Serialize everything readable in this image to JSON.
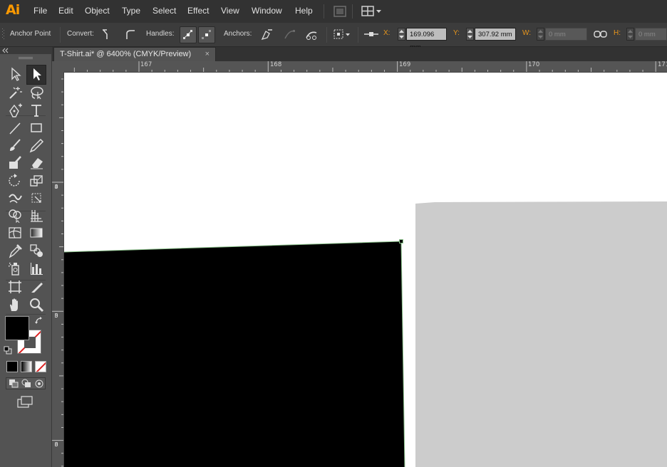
{
  "app": {
    "logo": "Ai"
  },
  "menu": [
    "File",
    "Edit",
    "Object",
    "Type",
    "Select",
    "Effect",
    "View",
    "Window",
    "Help"
  ],
  "control_bar": {
    "selection_label": "Anchor Point",
    "convert_label": "Convert:",
    "handles_label": "Handles:",
    "anchors_label": "Anchors:",
    "x_label": "X:",
    "x_value": "169.096 mm",
    "y_label": "Y:",
    "y_value": "307.92 mm",
    "w_label": "W:",
    "w_value": "0 mm",
    "h_label": "H:",
    "h_value": "0 mm"
  },
  "document": {
    "tab_title": "T-Shirt.ai* @ 6400% (CMYK/Preview)",
    "close_glyph": "×"
  },
  "ruler": {
    "top_labels": [
      "167",
      "168",
      "169",
      "170",
      "171"
    ],
    "left_labels": [
      [
        "3",
        "0",
        "4"
      ],
      [
        "3",
        "0",
        "5"
      ],
      [
        "3",
        "0",
        "6"
      ]
    ]
  },
  "colors": {
    "menubar": "#323232",
    "control_bar": "#3c3c3c",
    "panel": "#535353",
    "accent_orange": "#e8961c",
    "canvas_white": "#ffffff",
    "shape_black": "#000000",
    "shape_gray": "#cccccc",
    "selected_path": "#7fbf7f"
  },
  "tools": {
    "rows": [
      [
        "selection-tool-icon",
        "direct-selection-tool-icon"
      ],
      [
        "magic-wand-tool-icon",
        "lasso-tool-icon"
      ],
      [
        "pen-tool-icon",
        "type-tool-icon"
      ],
      [
        "line-segment-tool-icon",
        "rectangle-tool-icon"
      ],
      [
        "paintbrush-tool-icon",
        "pencil-tool-icon"
      ],
      [
        "blob-brush-tool-icon",
        "eraser-tool-icon"
      ],
      [
        "rotate-tool-icon",
        "scale-tool-icon"
      ],
      [
        "warp-tool-icon",
        "free-transform-tool-icon"
      ],
      [
        "shape-builder-tool-icon",
        "perspective-grid-tool-icon"
      ],
      [
        "mesh-tool-icon",
        "gradient-tool-icon"
      ],
      [
        "eyedropper-tool-icon",
        "blend-tool-icon"
      ],
      [
        "symbol-sprayer-tool-icon",
        "column-graph-tool-icon"
      ],
      [
        "artboard-tool-icon",
        "slice-tool-icon"
      ],
      [
        "hand-tool-icon",
        "zoom-tool-icon"
      ]
    ]
  }
}
